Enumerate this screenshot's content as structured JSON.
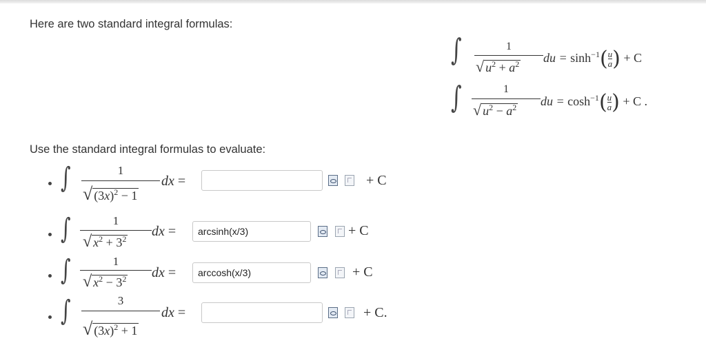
{
  "intro_text": "Here are two standard integral formulas:",
  "instructions_text": "Use the standard integral formulas to evaluate:",
  "formulas": [
    {
      "numerator": "1",
      "denominator": "u2 + a2",
      "den_base": "u",
      "den_op": "+",
      "den_base2": "a",
      "exp": "2",
      "differential": "du =",
      "function": "sinh",
      "inverse_exp": "−1",
      "frac_top": "u",
      "frac_bottom": "a",
      "constant": "+ C"
    },
    {
      "numerator": "1",
      "denominator": "u2 − a2",
      "den_base": "u",
      "den_op": "−",
      "den_base2": "a",
      "exp": "2",
      "differential": "du =",
      "function": "cosh",
      "inverse_exp": "−1",
      "frac_top": "u",
      "frac_bottom": "a",
      "constant": "+ C ."
    }
  ],
  "problems": [
    {
      "numerator": "1",
      "denominator": "(3x)2 − 1",
      "differential": "dx =",
      "answer_value": "",
      "constant": "+ C"
    },
    {
      "numerator": "1",
      "denominator": "x2 + 32",
      "differential": "dx =",
      "answer_value": "arcsinh(x/3)",
      "constant": "+ C"
    },
    {
      "numerator": "1",
      "denominator": "x2 − 32",
      "differential": "dx =",
      "answer_value": "arccosh(x/3)",
      "constant": "+ C"
    },
    {
      "numerator": "3",
      "denominator": "(3x)2 + 1",
      "differential": "dx =",
      "answer_value": "",
      "constant": "+ C."
    }
  ],
  "icons": [
    "preview-icon",
    "symbol-palette-icon"
  ],
  "colors": {
    "input_border": "#c8c8c8",
    "text": "#333333"
  }
}
